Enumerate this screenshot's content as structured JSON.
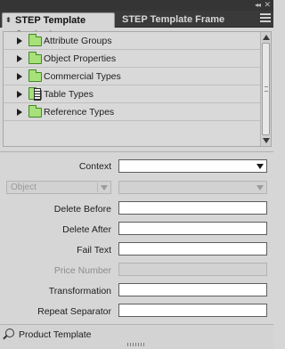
{
  "window": {
    "collapse_glyph": "◂◂",
    "close_glyph": "✕"
  },
  "tabs": [
    {
      "label": "STEP Template Content",
      "active": true
    },
    {
      "label": "STEP Template Frame",
      "active": false
    }
  ],
  "tree": {
    "items": [
      {
        "label": "Attribute Groups",
        "icon": "folder-icon"
      },
      {
        "label": "Object Properties",
        "icon": "folder-icon"
      },
      {
        "label": "Commercial Types",
        "icon": "folder-icon"
      },
      {
        "label": "Table Types",
        "icon": "table-folder-icon"
      },
      {
        "label": "Reference Types",
        "icon": "folder-icon"
      }
    ]
  },
  "form": {
    "context_label": "Context",
    "object_select_value": "Object",
    "delete_before_label": "Delete Before",
    "delete_after_label": "Delete After",
    "fail_text_label": "Fail Text",
    "price_number_label": "Price Number",
    "transformation_label": "Transformation",
    "repeat_separator_label": "Repeat Separator"
  },
  "footer": {
    "label": "Product Template"
  },
  "colors": {
    "panel_bg": "#d6d6d6",
    "tabbar_bg": "#3a3a3a",
    "folder_fill": "#a8e07a",
    "folder_stroke": "#3e8a22"
  }
}
